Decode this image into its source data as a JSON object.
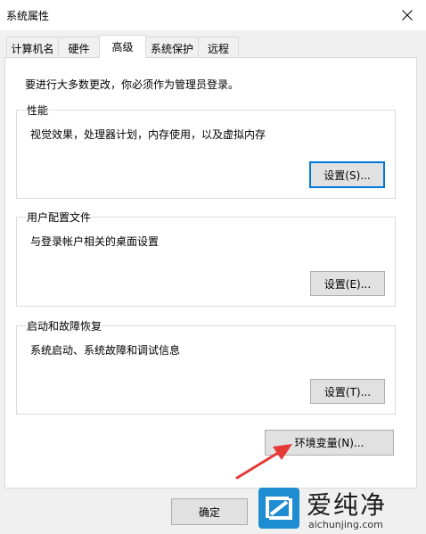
{
  "window": {
    "title": "系统属性"
  },
  "tabs": [
    {
      "label": "计算机名"
    },
    {
      "label": "硬件"
    },
    {
      "label": "高级",
      "active": true
    },
    {
      "label": "系统保护"
    },
    {
      "label": "远程"
    }
  ],
  "notice": "要进行大多数更改，你必须作为管理员登录。",
  "groups": {
    "performance": {
      "title": "性能",
      "description": "视觉效果，处理器计划，内存使用，以及虚拟内存",
      "button": "设置(S)..."
    },
    "user_profiles": {
      "title": "用户配置文件",
      "description": "与登录帐户相关的桌面设置",
      "button": "设置(E)..."
    },
    "startup_recovery": {
      "title": "启动和故障恢复",
      "description": "系统启动、系统故障和调试信息",
      "button": "设置(T)..."
    }
  },
  "env_button": "环境变量(N)...",
  "ok_button": "确定",
  "colors": {
    "accent": "#0078d7",
    "arrow": "#e53935",
    "watermark_logo": "#1d8cd0"
  },
  "watermark": {
    "text": "爱纯净",
    "url": "aichunjing.com"
  }
}
